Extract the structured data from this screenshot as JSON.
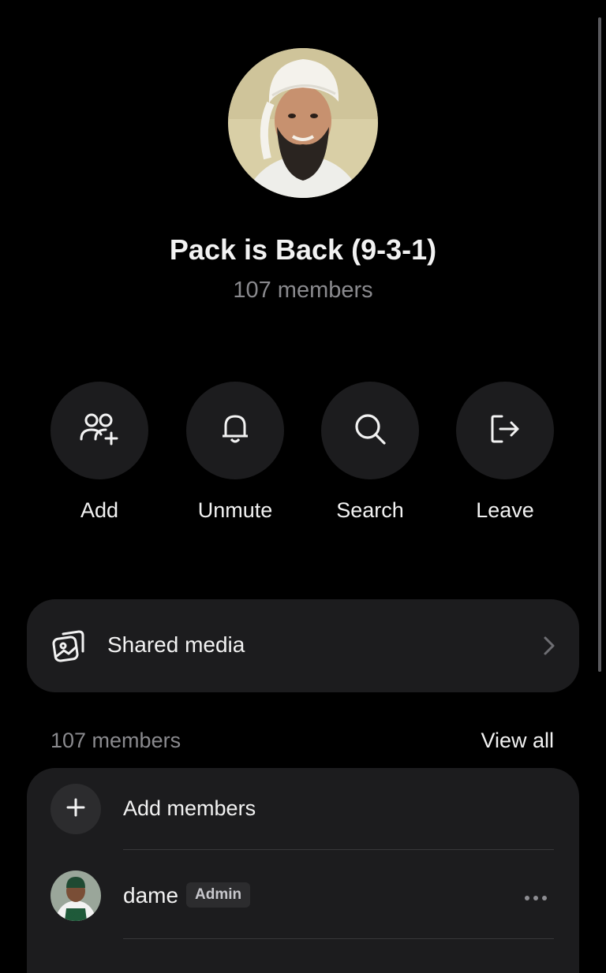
{
  "group": {
    "name": "Pack is Back (9-3-1)",
    "member_count_label": "107 members"
  },
  "actions": [
    {
      "label": "Add",
      "icon": "add-people-icon"
    },
    {
      "label": "Unmute",
      "icon": "bell-icon"
    },
    {
      "label": "Search",
      "icon": "search-icon"
    },
    {
      "label": "Leave",
      "icon": "leave-icon"
    }
  ],
  "shared_media": {
    "label": "Shared media",
    "icon": "gallery-icon"
  },
  "members_section": {
    "header": "107 members",
    "view_all": "View all",
    "add_label": "Add members",
    "members": [
      {
        "name": "dame",
        "badge": "Admin"
      }
    ]
  },
  "colors": {
    "background": "#000000",
    "card": "#1c1c1e",
    "secondary_text": "#8a8a8e",
    "primary_text": "#f2f2f2"
  }
}
